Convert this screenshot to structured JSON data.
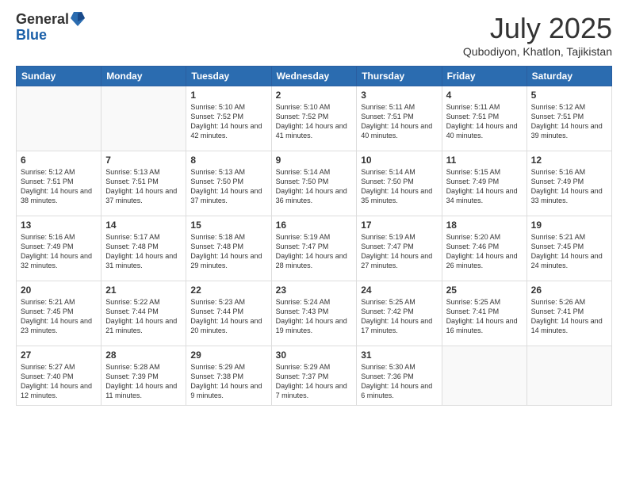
{
  "logo": {
    "general": "General",
    "blue": "Blue"
  },
  "header": {
    "month": "July 2025",
    "location": "Qubodiyon, Khatlon, Tajikistan"
  },
  "weekdays": [
    "Sunday",
    "Monday",
    "Tuesday",
    "Wednesday",
    "Thursday",
    "Friday",
    "Saturday"
  ],
  "weeks": [
    [
      {
        "day": "",
        "sunrise": "",
        "sunset": "",
        "daylight": ""
      },
      {
        "day": "",
        "sunrise": "",
        "sunset": "",
        "daylight": ""
      },
      {
        "day": "1",
        "sunrise": "Sunrise: 5:10 AM",
        "sunset": "Sunset: 7:52 PM",
        "daylight": "Daylight: 14 hours and 42 minutes."
      },
      {
        "day": "2",
        "sunrise": "Sunrise: 5:10 AM",
        "sunset": "Sunset: 7:52 PM",
        "daylight": "Daylight: 14 hours and 41 minutes."
      },
      {
        "day": "3",
        "sunrise": "Sunrise: 5:11 AM",
        "sunset": "Sunset: 7:51 PM",
        "daylight": "Daylight: 14 hours and 40 minutes."
      },
      {
        "day": "4",
        "sunrise": "Sunrise: 5:11 AM",
        "sunset": "Sunset: 7:51 PM",
        "daylight": "Daylight: 14 hours and 40 minutes."
      },
      {
        "day": "5",
        "sunrise": "Sunrise: 5:12 AM",
        "sunset": "Sunset: 7:51 PM",
        "daylight": "Daylight: 14 hours and 39 minutes."
      }
    ],
    [
      {
        "day": "6",
        "sunrise": "Sunrise: 5:12 AM",
        "sunset": "Sunset: 7:51 PM",
        "daylight": "Daylight: 14 hours and 38 minutes."
      },
      {
        "day": "7",
        "sunrise": "Sunrise: 5:13 AM",
        "sunset": "Sunset: 7:51 PM",
        "daylight": "Daylight: 14 hours and 37 minutes."
      },
      {
        "day": "8",
        "sunrise": "Sunrise: 5:13 AM",
        "sunset": "Sunset: 7:50 PM",
        "daylight": "Daylight: 14 hours and 37 minutes."
      },
      {
        "day": "9",
        "sunrise": "Sunrise: 5:14 AM",
        "sunset": "Sunset: 7:50 PM",
        "daylight": "Daylight: 14 hours and 36 minutes."
      },
      {
        "day": "10",
        "sunrise": "Sunrise: 5:14 AM",
        "sunset": "Sunset: 7:50 PM",
        "daylight": "Daylight: 14 hours and 35 minutes."
      },
      {
        "day": "11",
        "sunrise": "Sunrise: 5:15 AM",
        "sunset": "Sunset: 7:49 PM",
        "daylight": "Daylight: 14 hours and 34 minutes."
      },
      {
        "day": "12",
        "sunrise": "Sunrise: 5:16 AM",
        "sunset": "Sunset: 7:49 PM",
        "daylight": "Daylight: 14 hours and 33 minutes."
      }
    ],
    [
      {
        "day": "13",
        "sunrise": "Sunrise: 5:16 AM",
        "sunset": "Sunset: 7:49 PM",
        "daylight": "Daylight: 14 hours and 32 minutes."
      },
      {
        "day": "14",
        "sunrise": "Sunrise: 5:17 AM",
        "sunset": "Sunset: 7:48 PM",
        "daylight": "Daylight: 14 hours and 31 minutes."
      },
      {
        "day": "15",
        "sunrise": "Sunrise: 5:18 AM",
        "sunset": "Sunset: 7:48 PM",
        "daylight": "Daylight: 14 hours and 29 minutes."
      },
      {
        "day": "16",
        "sunrise": "Sunrise: 5:19 AM",
        "sunset": "Sunset: 7:47 PM",
        "daylight": "Daylight: 14 hours and 28 minutes."
      },
      {
        "day": "17",
        "sunrise": "Sunrise: 5:19 AM",
        "sunset": "Sunset: 7:47 PM",
        "daylight": "Daylight: 14 hours and 27 minutes."
      },
      {
        "day": "18",
        "sunrise": "Sunrise: 5:20 AM",
        "sunset": "Sunset: 7:46 PM",
        "daylight": "Daylight: 14 hours and 26 minutes."
      },
      {
        "day": "19",
        "sunrise": "Sunrise: 5:21 AM",
        "sunset": "Sunset: 7:45 PM",
        "daylight": "Daylight: 14 hours and 24 minutes."
      }
    ],
    [
      {
        "day": "20",
        "sunrise": "Sunrise: 5:21 AM",
        "sunset": "Sunset: 7:45 PM",
        "daylight": "Daylight: 14 hours and 23 minutes."
      },
      {
        "day": "21",
        "sunrise": "Sunrise: 5:22 AM",
        "sunset": "Sunset: 7:44 PM",
        "daylight": "Daylight: 14 hours and 21 minutes."
      },
      {
        "day": "22",
        "sunrise": "Sunrise: 5:23 AM",
        "sunset": "Sunset: 7:44 PM",
        "daylight": "Daylight: 14 hours and 20 minutes."
      },
      {
        "day": "23",
        "sunrise": "Sunrise: 5:24 AM",
        "sunset": "Sunset: 7:43 PM",
        "daylight": "Daylight: 14 hours and 19 minutes."
      },
      {
        "day": "24",
        "sunrise": "Sunrise: 5:25 AM",
        "sunset": "Sunset: 7:42 PM",
        "daylight": "Daylight: 14 hours and 17 minutes."
      },
      {
        "day": "25",
        "sunrise": "Sunrise: 5:25 AM",
        "sunset": "Sunset: 7:41 PM",
        "daylight": "Daylight: 14 hours and 16 minutes."
      },
      {
        "day": "26",
        "sunrise": "Sunrise: 5:26 AM",
        "sunset": "Sunset: 7:41 PM",
        "daylight": "Daylight: 14 hours and 14 minutes."
      }
    ],
    [
      {
        "day": "27",
        "sunrise": "Sunrise: 5:27 AM",
        "sunset": "Sunset: 7:40 PM",
        "daylight": "Daylight: 14 hours and 12 minutes."
      },
      {
        "day": "28",
        "sunrise": "Sunrise: 5:28 AM",
        "sunset": "Sunset: 7:39 PM",
        "daylight": "Daylight: 14 hours and 11 minutes."
      },
      {
        "day": "29",
        "sunrise": "Sunrise: 5:29 AM",
        "sunset": "Sunset: 7:38 PM",
        "daylight": "Daylight: 14 hours and 9 minutes."
      },
      {
        "day": "30",
        "sunrise": "Sunrise: 5:29 AM",
        "sunset": "Sunset: 7:37 PM",
        "daylight": "Daylight: 14 hours and 7 minutes."
      },
      {
        "day": "31",
        "sunrise": "Sunrise: 5:30 AM",
        "sunset": "Sunset: 7:36 PM",
        "daylight": "Daylight: 14 hours and 6 minutes."
      },
      {
        "day": "",
        "sunrise": "",
        "sunset": "",
        "daylight": ""
      },
      {
        "day": "",
        "sunrise": "",
        "sunset": "",
        "daylight": ""
      }
    ]
  ]
}
